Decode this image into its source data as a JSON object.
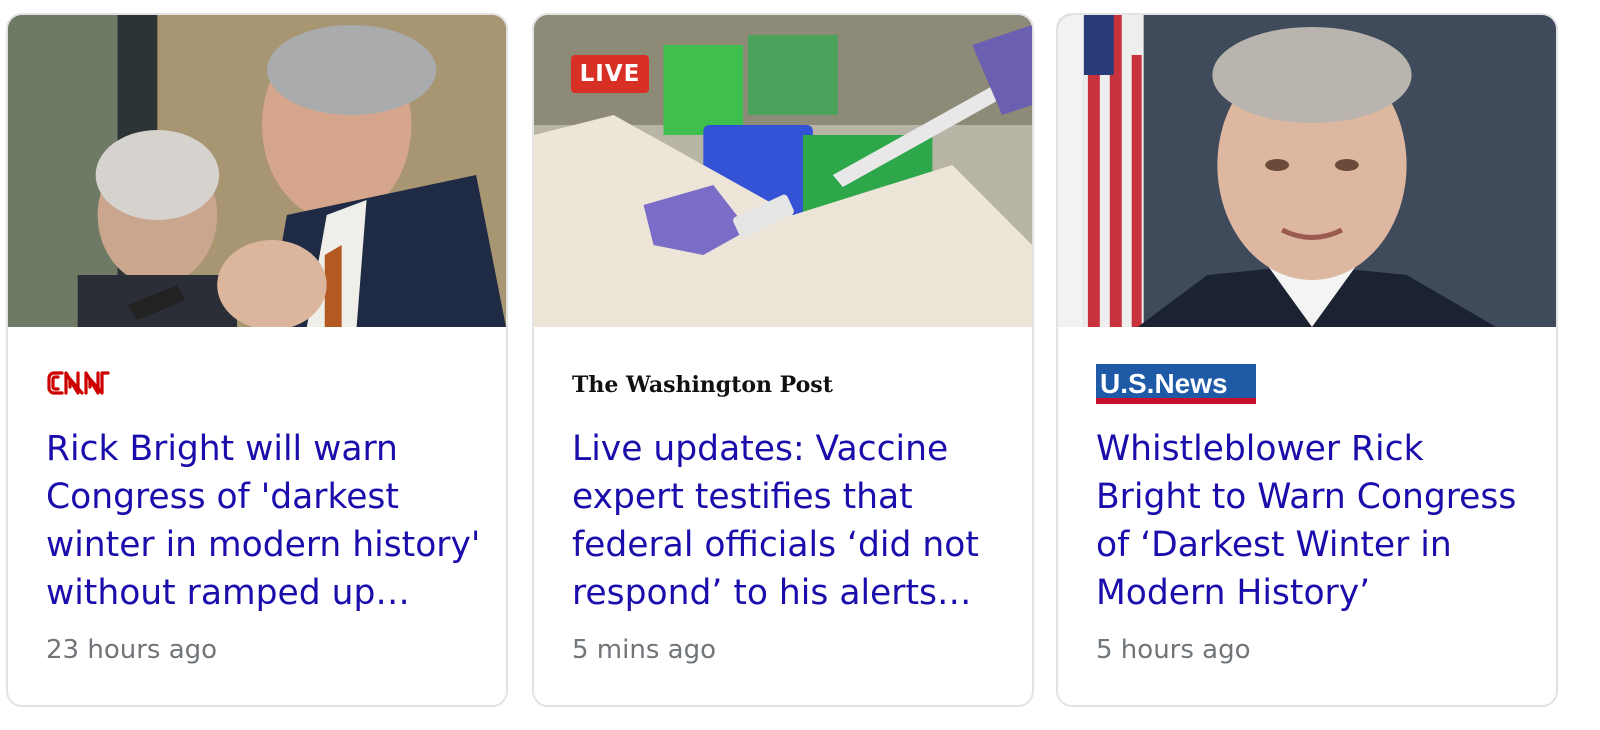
{
  "cards": [
    {
      "source": "CNN",
      "title": "Rick Bright will warn Congress of 'darkest winter in modern history' without ramped up…",
      "time": "23 hours ago",
      "image_alt": "Rick Bright and Dr. Fauci at a congressional hearing"
    },
    {
      "source": "The Washington Post",
      "badge": "LIVE",
      "title": "Live updates: Vaccine expert testifies that federal officials ‘did not respond’ to his alerts…",
      "time": "5 mins ago",
      "image_alt": "Lab worker in protective gear handling vaccine samples"
    },
    {
      "source": "U.S.News",
      "title": "Whistleblower Rick Bright to Warn Congress of ‘Darkest Winter in Modern History’",
      "time": "5 hours ago",
      "image_alt": "Portrait of Rick Bright in front of an American flag"
    }
  ],
  "colors": {
    "title": "#1a0dab",
    "time": "#70757a",
    "live_badge": "#d93025",
    "cnn_red": "#cc0000",
    "usnews_blue": "#1f5aa6"
  }
}
